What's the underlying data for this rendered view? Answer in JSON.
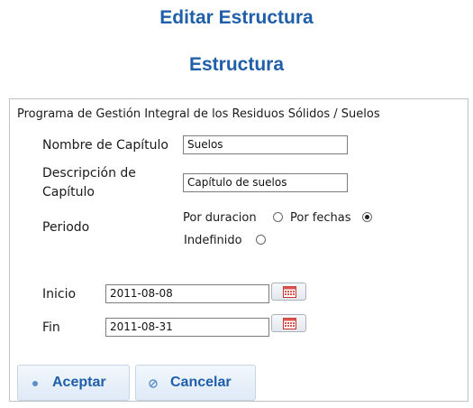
{
  "page": {
    "title": "Editar Estructura",
    "subtitle": "Estructura"
  },
  "form": {
    "program_title": "Programa de Gestión Integral de los Residuos Sólidos / Suelos",
    "nombre_label": "Nombre de Capítulo",
    "nombre_value": "Suelos",
    "descripcion_label_line1": "Descripción de",
    "descripcion_label_line2": "Capítulo",
    "descripcion_value": "Capítulo de suelos",
    "periodo_label": "Periodo",
    "periodo_options": [
      {
        "label": "Por duracion",
        "checked": false
      },
      {
        "label": "Por fechas",
        "checked": true
      },
      {
        "label": "Indefinido",
        "checked": false
      }
    ],
    "inicio_label": "Inicio",
    "inicio_value": "2011-08-08",
    "fin_label": "Fin",
    "fin_value": "2011-08-31"
  },
  "buttons": {
    "accept_label": "Aceptar",
    "cancel_label": "Cancelar"
  },
  "colors": {
    "accent": "#1f5ea8",
    "button_bg": "#e6f0fa",
    "calendar_red": "#d9534f"
  },
  "icons": {
    "calendar": "calendar-icon",
    "accept": "bullet-icon",
    "cancel": "cancel-icon"
  }
}
